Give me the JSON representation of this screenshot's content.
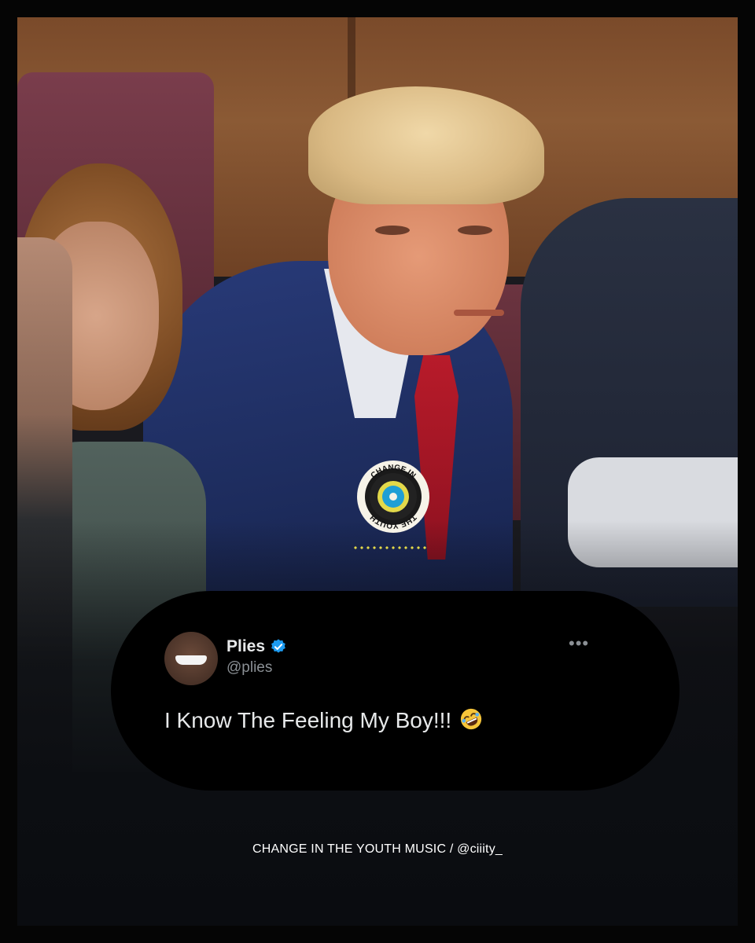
{
  "tweet": {
    "name": "Plies",
    "handle": "@plies",
    "text": "I Know The Feeling My Boy!!!",
    "emoji_icon": "rolling-on-floor-laughing-emoji"
  },
  "logo": {
    "top_text": "CHANGE IN",
    "bottom_text": "THE YOUTH",
    "accent": "#e3d94a"
  },
  "footer": {
    "credit": "CHANGE IN THE YOUTH MUSIC / @ciiity_"
  },
  "colors": {
    "card": "#000000",
    "text": "#e7e9ea",
    "muted": "#8b9095",
    "verified": "#1d9bf0"
  }
}
